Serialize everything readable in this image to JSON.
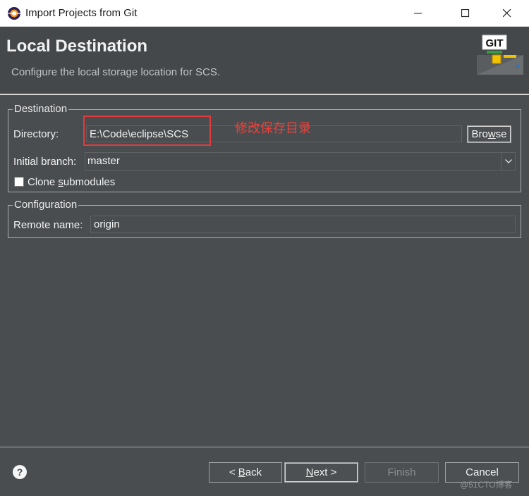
{
  "window": {
    "title": "Import Projects from Git",
    "icon": "eclipse-app-icon",
    "controls": [
      "minimize-icon",
      "maximize-icon",
      "close-icon"
    ]
  },
  "header": {
    "title": "Local Destination",
    "description": "Configure the local storage location for SCS.",
    "banner_label": "GIT"
  },
  "destination": {
    "legend": "Destination",
    "directory_label": "Directory:",
    "directory_value": "E:\\Code\\eclipse\\SCS",
    "browse_pre": "Bro",
    "browse_mn": "w",
    "browse_post": "se",
    "annotation": "修改保存目录",
    "annotation_color": "#e23b3b",
    "initial_branch_label": "Initial branch:",
    "initial_branch_value": "master",
    "clone_pre": "Clone ",
    "clone_mn": "s",
    "clone_post": "ubmodules",
    "clone_checked": false
  },
  "configuration": {
    "legend": "Configuration",
    "remote_name_label": "Remote name:",
    "remote_name_value": "origin"
  },
  "footer": {
    "back_pre": "< ",
    "back_mn": "B",
    "back_post": "ack",
    "next_mn": "N",
    "next_post": "ext >",
    "finish": "Finish",
    "finish_enabled": false,
    "cancel": "Cancel",
    "help_icon": "help-icon",
    "watermark": "@51CTO博客"
  },
  "colors": {
    "background": "#4a4d50",
    "titlebar": "#ffffff",
    "text": "#e8e8e8"
  }
}
